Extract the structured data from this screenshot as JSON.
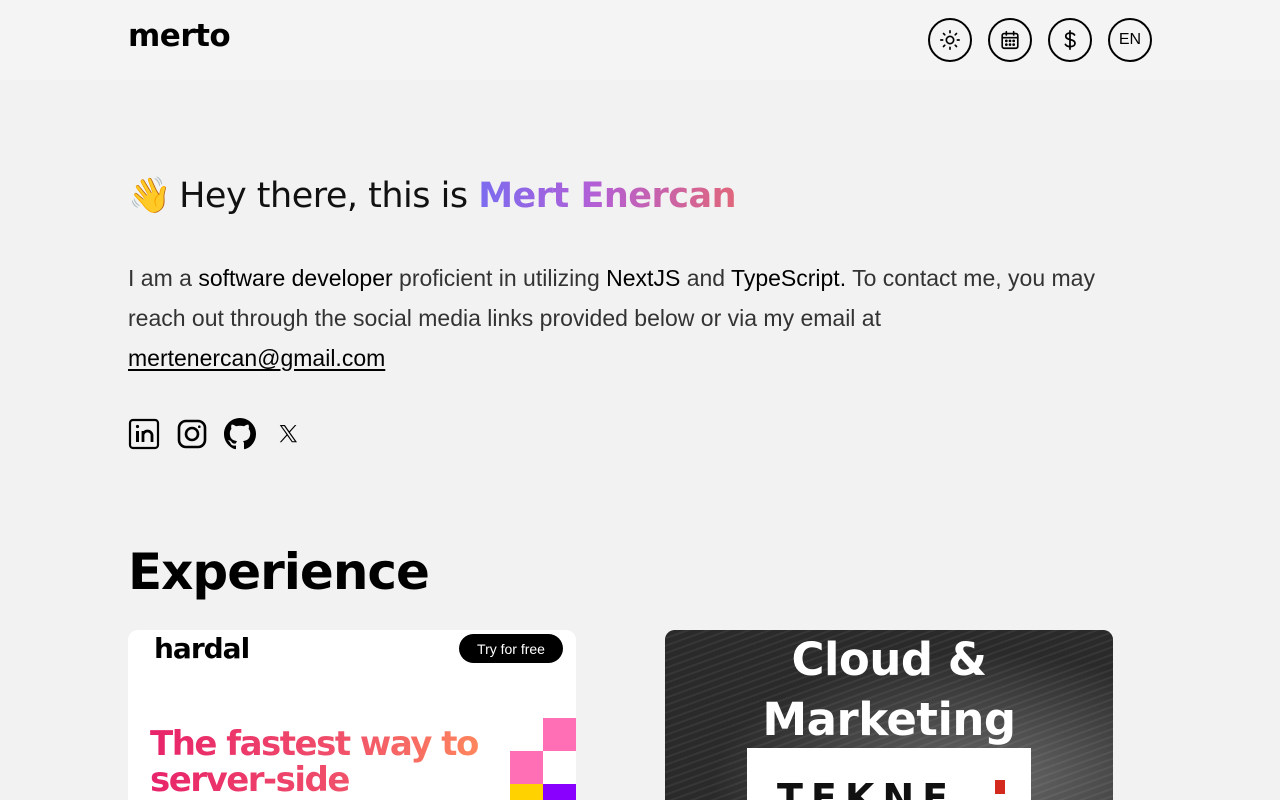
{
  "header": {
    "logo": "merto",
    "buttons": [
      {
        "name": "theme-toggle",
        "icon": "sun-icon"
      },
      {
        "name": "calendar",
        "icon": "calendar-icon"
      },
      {
        "name": "currency",
        "icon": "dollar-icon"
      },
      {
        "name": "language",
        "label": "EN"
      }
    ]
  },
  "hero": {
    "wave_emoji": "👋",
    "greeting": "Hey there, this is",
    "name": "Mert Enercan",
    "intro_1": "I am a",
    "intro_role": "software developer",
    "intro_2": "proficient in utilizing",
    "intro_tech1": "NextJS",
    "intro_and": "and",
    "intro_tech2": "TypeScript.",
    "intro_3": "To contact me, you may reach out through the social media links provided below or via my email at",
    "email": "mertenercan@gmail.com"
  },
  "socials": [
    {
      "name": "linkedin",
      "icon": "linkedin-icon"
    },
    {
      "name": "instagram",
      "icon": "instagram-icon"
    },
    {
      "name": "github",
      "icon": "github-icon"
    },
    {
      "name": "x",
      "icon": "x-icon"
    }
  ],
  "experience": {
    "title": "Experience",
    "cards": [
      {
        "brand": "hardal",
        "cta": "Try for free",
        "tagline": "The fastest way to server-side",
        "colors": [
          "#ff6fb5",
          "#ffffff",
          "#ff6fb5",
          "#ffd200",
          "#8a00ff"
        ]
      },
      {
        "title": "Cloud & Marketing Technology",
        "logo": "TEKNE"
      }
    ]
  },
  "colors": {
    "background": "#f2f2f2",
    "name_gradient_start": "#7b6cf0",
    "name_gradient_end": "#e0667a"
  }
}
